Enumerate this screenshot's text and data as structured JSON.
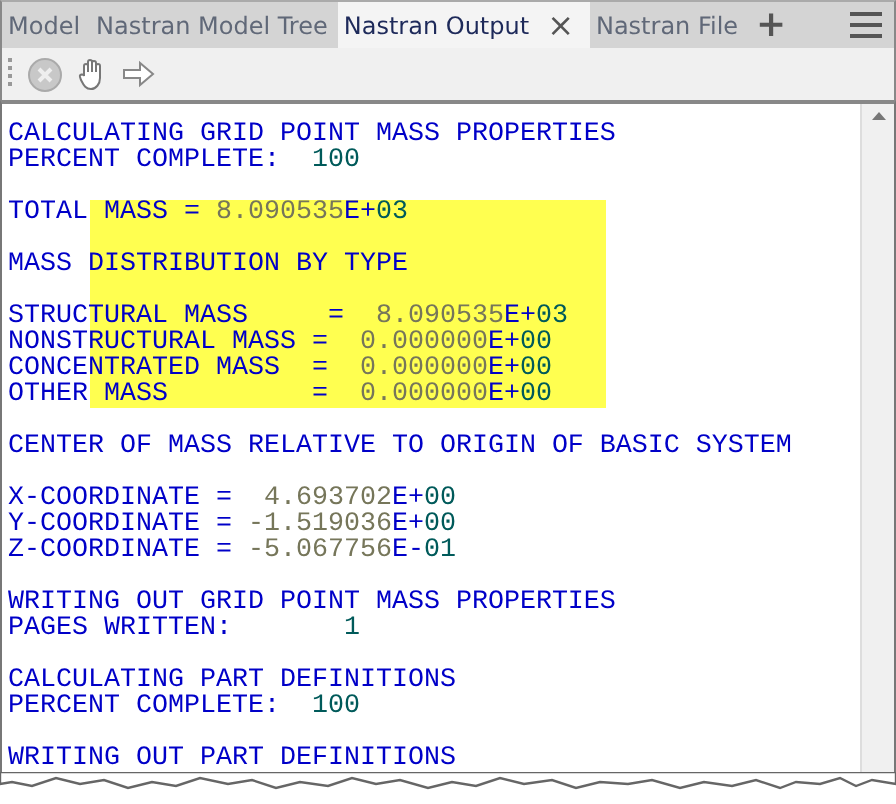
{
  "tabs": [
    {
      "label": "Model",
      "selected": false,
      "closable": false
    },
    {
      "label": "Nastran Model Tree",
      "selected": false,
      "closable": false
    },
    {
      "label": "Nastran Output",
      "selected": true,
      "closable": true
    },
    {
      "label": "Nastran File",
      "selected": false,
      "closable": false
    }
  ],
  "tab_close": "×",
  "tab_add": "+",
  "output": {
    "lines": [
      {
        "highlighted": false,
        "segments": [
          {
            "kind": "word",
            "text": "CALCULATING GRID POINT MASS PROPERTIES"
          }
        ]
      },
      {
        "highlighted": false,
        "segments": [
          {
            "kind": "word",
            "text": "PERCENT COMPLETE:  "
          },
          {
            "kind": "int",
            "text": "100"
          }
        ]
      },
      {
        "highlighted": false
      },
      {
        "highlighted": true,
        "segments": [
          {
            "kind": "word",
            "text": "TOTAL MASS = "
          },
          {
            "kind": "mantissa",
            "text": "8.090535"
          },
          {
            "kind": "word",
            "text": "E+"
          },
          {
            "kind": "int",
            "text": "03"
          }
        ]
      },
      {
        "highlighted": true
      },
      {
        "highlighted": true,
        "segments": [
          {
            "kind": "word",
            "text": "MASS DISTRIBUTION BY TYPE"
          }
        ]
      },
      {
        "highlighted": true
      },
      {
        "highlighted": true,
        "segments": [
          {
            "kind": "word",
            "text": "STRUCTURAL MASS     =  "
          },
          {
            "kind": "mantissa",
            "text": "8.090535"
          },
          {
            "kind": "word",
            "text": "E+"
          },
          {
            "kind": "int",
            "text": "03"
          }
        ]
      },
      {
        "highlighted": true,
        "segments": [
          {
            "kind": "word",
            "text": "NONSTRUCTURAL MASS =  "
          },
          {
            "kind": "mantissa",
            "text": "0.000000"
          },
          {
            "kind": "word",
            "text": "E+"
          },
          {
            "kind": "int",
            "text": "00"
          }
        ]
      },
      {
        "highlighted": true,
        "segments": [
          {
            "kind": "word",
            "text": "CONCENTRATED MASS  =  "
          },
          {
            "kind": "mantissa",
            "text": "0.000000"
          },
          {
            "kind": "word",
            "text": "E+"
          },
          {
            "kind": "int",
            "text": "00"
          }
        ]
      },
      {
        "highlighted": true,
        "segments": [
          {
            "kind": "word",
            "text": "OTHER MASS         =  "
          },
          {
            "kind": "mantissa",
            "text": "0.000000"
          },
          {
            "kind": "word",
            "text": "E+"
          },
          {
            "kind": "int",
            "text": "00"
          }
        ]
      },
      {
        "highlighted": false
      },
      {
        "highlighted": false,
        "segments": [
          {
            "kind": "word",
            "text": "CENTER OF MASS RELATIVE TO ORIGIN OF BASIC SYSTEM"
          }
        ]
      },
      {
        "highlighted": false
      },
      {
        "highlighted": false,
        "segments": [
          {
            "kind": "word",
            "text": "X-COORDINATE =  "
          },
          {
            "kind": "mantissa",
            "text": "4.693702"
          },
          {
            "kind": "word",
            "text": "E+"
          },
          {
            "kind": "int",
            "text": "00"
          }
        ]
      },
      {
        "highlighted": false,
        "segments": [
          {
            "kind": "word",
            "text": "Y-COORDINATE = "
          },
          {
            "kind": "mantissa",
            "text": "-1.519036"
          },
          {
            "kind": "word",
            "text": "E+"
          },
          {
            "kind": "int",
            "text": "00"
          }
        ]
      },
      {
        "highlighted": false,
        "segments": [
          {
            "kind": "word",
            "text": "Z-COORDINATE = "
          },
          {
            "kind": "mantissa",
            "text": "-5.067756"
          },
          {
            "kind": "word",
            "text": "E-"
          },
          {
            "kind": "int",
            "text": "01"
          }
        ]
      },
      {
        "highlighted": false
      },
      {
        "highlighted": false,
        "segments": [
          {
            "kind": "word",
            "text": "WRITING OUT GRID POINT MASS PROPERTIES"
          }
        ]
      },
      {
        "highlighted": false,
        "segments": [
          {
            "kind": "word",
            "text": "PAGES WRITTEN:       "
          },
          {
            "kind": "int",
            "text": "1"
          }
        ]
      },
      {
        "highlighted": false
      },
      {
        "highlighted": false,
        "segments": [
          {
            "kind": "word",
            "text": "CALCULATING PART DEFINITIONS"
          }
        ]
      },
      {
        "highlighted": false,
        "segments": [
          {
            "kind": "word",
            "text": "PERCENT COMPLETE:  "
          },
          {
            "kind": "int",
            "text": "100"
          }
        ]
      },
      {
        "highlighted": false
      },
      {
        "highlighted": false,
        "segments": [
          {
            "kind": "word",
            "text": "WRITING OUT PART DEFINITIONS"
          }
        ]
      }
    ]
  }
}
